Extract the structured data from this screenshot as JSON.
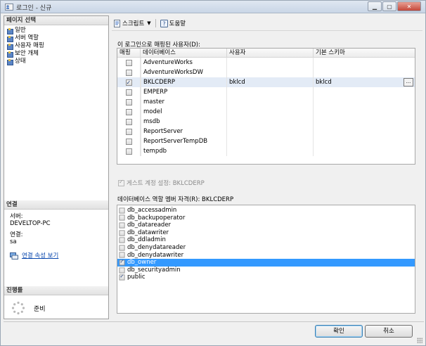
{
  "window": {
    "title": "로그인 - 신규"
  },
  "left": {
    "pages_header": "페이지 선택",
    "pages": [
      "일반",
      "서버 역할",
      "사용자 매핑",
      "보안 개체",
      "상태"
    ],
    "connection_header": "연결",
    "server_label": "서버:",
    "server_value": "DEVELTOP-PC",
    "connection_label": "연결:",
    "connection_value": "sa",
    "connection_link": "연결 속성 보기",
    "progress_header": "진행률",
    "progress_status": "준비"
  },
  "toolbar": {
    "script_label": "스크립트",
    "help_label": "도움말"
  },
  "mapping": {
    "label": "이 로그인으로 매핑된 사용자(D):",
    "columns": [
      "매핑",
      "데이터베이스",
      "사용자",
      "기본 스키마"
    ],
    "rows": [
      {
        "mapped": false,
        "database": "AdventureWorks",
        "user": "",
        "schema": ""
      },
      {
        "mapped": false,
        "database": "AdventureWorksDW",
        "user": "",
        "schema": ""
      },
      {
        "mapped": true,
        "database": "BKLCDERP",
        "user": "bklcd",
        "schema": "bklcd",
        "selected": true
      },
      {
        "mapped": false,
        "database": "EMPERP",
        "user": "",
        "schema": ""
      },
      {
        "mapped": false,
        "database": "master",
        "user": "",
        "schema": ""
      },
      {
        "mapped": false,
        "database": "model",
        "user": "",
        "schema": ""
      },
      {
        "mapped": false,
        "database": "msdb",
        "user": "",
        "schema": ""
      },
      {
        "mapped": false,
        "database": "ReportServer",
        "user": "",
        "schema": ""
      },
      {
        "mapped": false,
        "database": "ReportServerTempDB",
        "user": "",
        "schema": ""
      },
      {
        "mapped": false,
        "database": "tempdb",
        "user": "",
        "schema": ""
      }
    ],
    "ellipsis": "..."
  },
  "guest": {
    "label": "게스트 계정 설정: BKLCDERP",
    "checked": true
  },
  "roles": {
    "label": "데이터베이스 역할 멤버 자격(R): BKLCDERP",
    "items": [
      {
        "name": "db_accessadmin",
        "checked": false
      },
      {
        "name": "db_backupoperator",
        "checked": false
      },
      {
        "name": "db_datareader",
        "checked": false
      },
      {
        "name": "db_datawriter",
        "checked": false
      },
      {
        "name": "db_ddladmin",
        "checked": false
      },
      {
        "name": "db_denydatareader",
        "checked": false
      },
      {
        "name": "db_denydatawriter",
        "checked": false
      },
      {
        "name": "db_owner",
        "checked": true,
        "selected": true
      },
      {
        "name": "db_securityadmin",
        "checked": false
      },
      {
        "name": "public",
        "checked": true
      }
    ]
  },
  "buttons": {
    "ok": "확인",
    "cancel": "취소"
  }
}
